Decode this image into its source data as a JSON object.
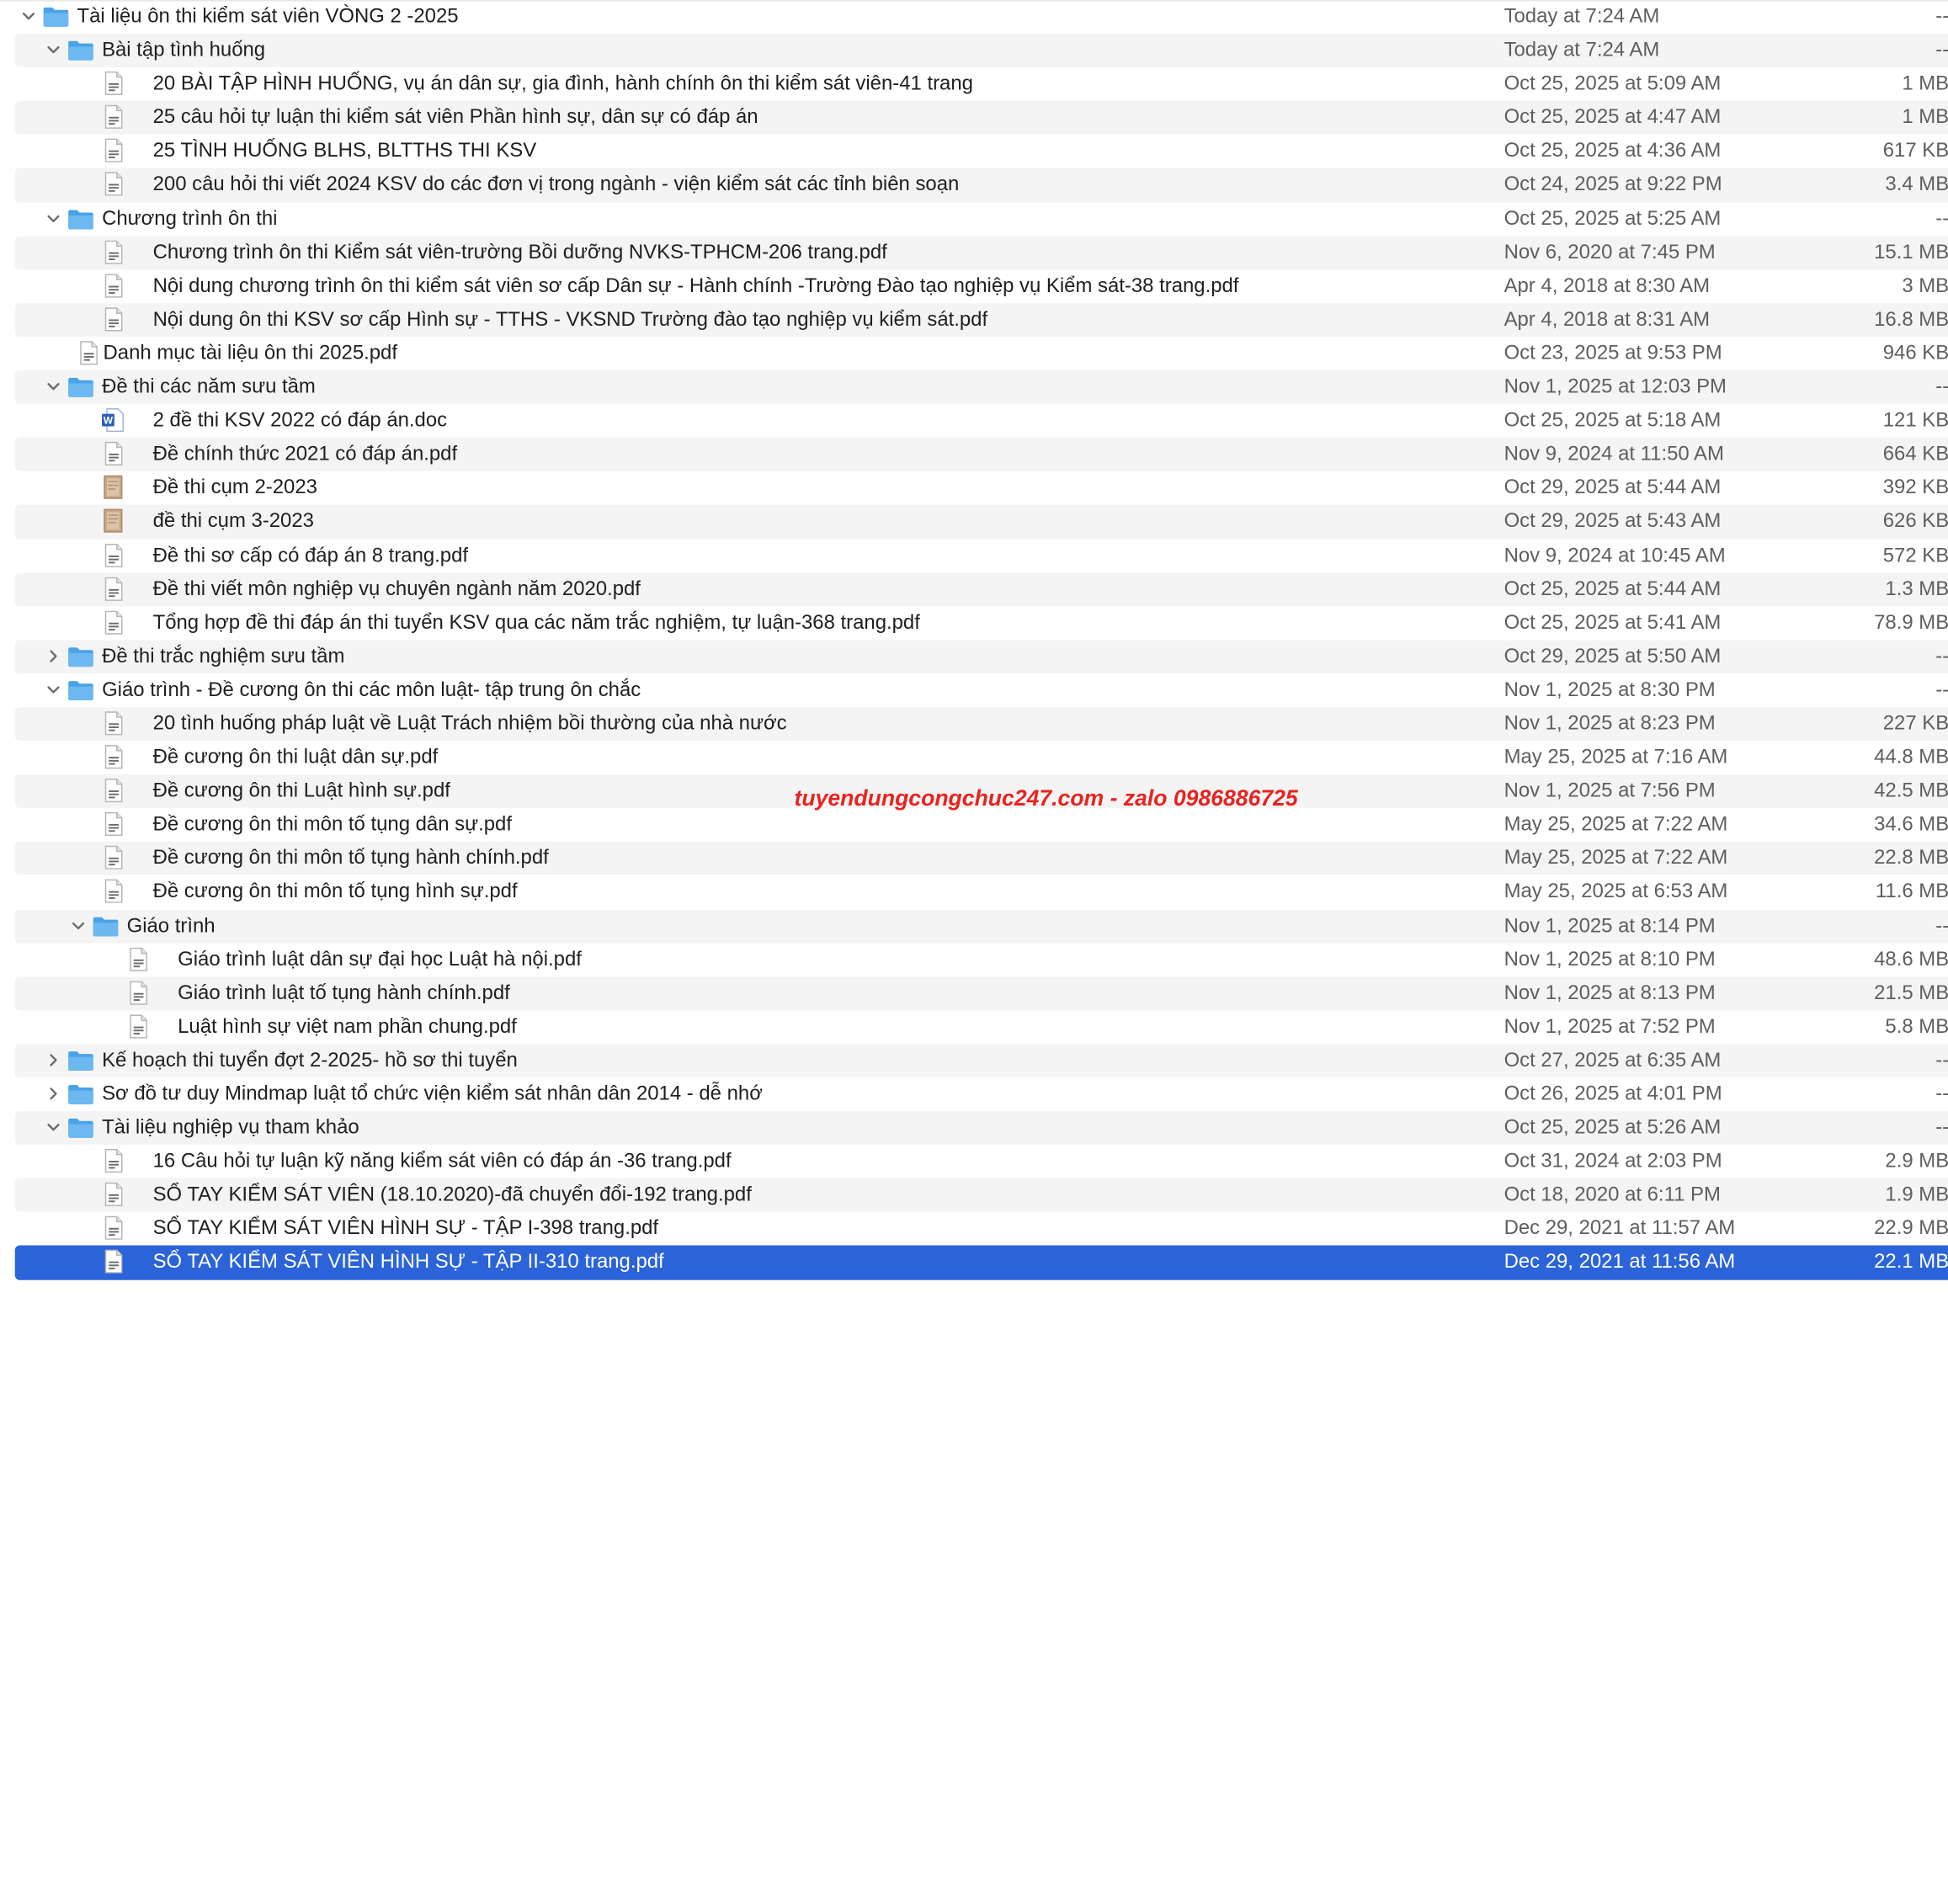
{
  "watermark": "tuyendungcongchuc247.com - zalo 0986886725",
  "colors": {
    "selection": "#2b63d9",
    "folder": "#4aa3e8",
    "stripe": "#f4f4f4",
    "secondary_text": "#5e5e5e",
    "watermark": "#e8231f"
  },
  "rows": [
    {
      "level": 0,
      "type": "folder",
      "expanded": true,
      "name": "Tài liệu ôn thi kiểm sát viên VÒNG 2 -2025",
      "date": "Today at 7:24 AM",
      "size": "--"
    },
    {
      "level": 1,
      "type": "folder",
      "expanded": true,
      "name": "Bài tập tình huống",
      "date": "Today at 7:24 AM",
      "size": "--"
    },
    {
      "level": 2,
      "type": "pdf",
      "name": "20 BÀI TẬP HÌNH HUỐNG, vụ án dân sự, gia đình, hành chính ôn thi kiểm sát viên-41 trang",
      "date": "Oct 25, 2025 at 5:09 AM",
      "size": "1 MB"
    },
    {
      "level": 2,
      "type": "pdf",
      "name": "25 câu hỏi tự luận thi kiểm sát viên Phần hình sự, dân sự có đáp án",
      "date": "Oct 25, 2025 at 4:47 AM",
      "size": "1 MB"
    },
    {
      "level": 2,
      "type": "pdf",
      "name": "25 TÌNH HUỐNG BLHS, BLTTHS THI KSV",
      "date": "Oct 25, 2025 at 4:36 AM",
      "size": "617 KB"
    },
    {
      "level": 2,
      "type": "pdf",
      "name": "200 câu hỏi thi viết 2024 KSV do các đơn vị trong ngành - viện kiểm sát các tỉnh biên soạn",
      "date": "Oct 24, 2025 at 9:22 PM",
      "size": "3.4 MB"
    },
    {
      "level": 1,
      "type": "folder",
      "expanded": true,
      "name": "Chương trình ôn thi",
      "date": "Oct 25, 2025 at 5:25 AM",
      "size": "--"
    },
    {
      "level": 2,
      "type": "pdf",
      "name": "Chương trình ôn thi Kiểm sát viên-trường Bồi dưỡng NVKS-TPHCM-206 trang.pdf",
      "date": "Nov 6, 2020 at 7:45 PM",
      "size": "15.1 MB"
    },
    {
      "level": 2,
      "type": "pdf",
      "name": "Nội dung chương trình ôn thi kiểm sát viên sơ cấp Dân sự - Hành chính -Trường Đào tạo nghiệp vụ Kiểm sát-38 trang.pdf",
      "date": "Apr 4, 2018 at 8:30 AM",
      "size": "3 MB"
    },
    {
      "level": 2,
      "type": "pdf",
      "name": "Nội dung ôn thi KSV sơ cấp Hình sự - TTHS - VKSND Trường đào tạo nghiệp vụ kiểm sát.pdf",
      "date": "Apr 4, 2018 at 8:31 AM",
      "size": "16.8 MB"
    },
    {
      "level": 1,
      "type": "pdf",
      "name": "Danh mục tài liệu ôn thi 2025.pdf",
      "date": "Oct 23, 2025 at 9:53 PM",
      "size": "946 KB"
    },
    {
      "level": 1,
      "type": "folder",
      "expanded": true,
      "name": "Đề thi các năm sưu tầm",
      "date": "Nov 1, 2025 at 12:03 PM",
      "size": "--"
    },
    {
      "level": 2,
      "type": "doc",
      "name": "2 đề thi KSV 2022 có đáp án.doc",
      "date": "Oct 25, 2025 at 5:18 AM",
      "size": "121 KB"
    },
    {
      "level": 2,
      "type": "pdf",
      "name": "Đề chính thức 2021 có đáp án.pdf",
      "date": "Nov 9, 2024 at 11:50 AM",
      "size": "664 KB"
    },
    {
      "level": 2,
      "type": "image",
      "name": "Đề thi cụm 2-2023",
      "date": "Oct 29, 2025 at 5:44 AM",
      "size": "392 KB"
    },
    {
      "level": 2,
      "type": "image",
      "name": "đề thi cụm 3-2023",
      "date": "Oct 29, 2025 at 5:43 AM",
      "size": "626 KB"
    },
    {
      "level": 2,
      "type": "pdf",
      "name": "Đề thi sơ cấp có đáp án 8 trang.pdf",
      "date": "Nov 9, 2024 at 10:45 AM",
      "size": "572 KB"
    },
    {
      "level": 2,
      "type": "pdf",
      "name": "Đề thi viết môn nghiệp vụ chuyên ngành năm 2020.pdf",
      "date": "Oct 25, 2025 at 5:44 AM",
      "size": "1.3 MB"
    },
    {
      "level": 2,
      "type": "pdf",
      "name": "Tổng hợp đề thi đáp án thi tuyển KSV qua các năm trắc nghiệm, tự luận-368 trang.pdf",
      "date": "Oct 25, 2025 at 5:41 AM",
      "size": "78.9 MB"
    },
    {
      "level": 1,
      "type": "folder",
      "expanded": false,
      "name": "Đề thi trắc nghiệm sưu tầm",
      "date": "Oct 29, 2025 at 5:50 AM",
      "size": "--"
    },
    {
      "level": 1,
      "type": "folder",
      "expanded": true,
      "name": "Giáo trình - Đề cương ôn thi các môn luật- tập trung ôn chắc",
      "date": "Nov 1, 2025 at 8:30 PM",
      "size": "--"
    },
    {
      "level": 2,
      "type": "pdf",
      "name": "20 tình huống pháp luật về Luật Trách nhiệm bồi thường của nhà nước",
      "date": "Nov 1, 2025 at 8:23 PM",
      "size": "227 KB"
    },
    {
      "level": 2,
      "type": "pdf",
      "name": "Đề cương ôn thi luật dân sự.pdf",
      "date": "May 25, 2025 at 7:16 AM",
      "size": "44.8 MB"
    },
    {
      "level": 2,
      "type": "pdf",
      "name": "Đề cương ôn thi Luật hình sự.pdf",
      "date": "Nov 1, 2025 at 7:56 PM",
      "size": "42.5 MB"
    },
    {
      "level": 2,
      "type": "pdf",
      "name": "Đề cương ôn thi môn tố tụng dân sự.pdf",
      "date": "May 25, 2025 at 7:22 AM",
      "size": "34.6 MB"
    },
    {
      "level": 2,
      "type": "pdf",
      "name": "Đề cương ôn thi môn tố tụng hành chính.pdf",
      "date": "May 25, 2025 at 7:22 AM",
      "size": "22.8 MB"
    },
    {
      "level": 2,
      "type": "pdf",
      "name": "Đề cương ôn thi môn tố tụng hình sự.pdf",
      "date": "May 25, 2025 at 6:53 AM",
      "size": "11.6 MB"
    },
    {
      "level": 2,
      "type": "folder",
      "expanded": true,
      "name": "Giáo trình",
      "date": "Nov 1, 2025 at 8:14 PM",
      "size": "--"
    },
    {
      "level": 3,
      "type": "pdf",
      "name": "Giáo trình luật dân sự đại học Luật hà nội.pdf",
      "date": "Nov 1, 2025 at 8:10 PM",
      "size": "48.6 MB"
    },
    {
      "level": 3,
      "type": "pdf",
      "name": "Giáo trình luật tố tụng hành chính.pdf",
      "date": "Nov 1, 2025 at 8:13 PM",
      "size": "21.5 MB"
    },
    {
      "level": 3,
      "type": "pdf",
      "name": "Luật hình sự việt nam phần chung.pdf",
      "date": "Nov 1, 2025 at 7:52 PM",
      "size": "5.8 MB"
    },
    {
      "level": 1,
      "type": "folder",
      "expanded": false,
      "name": "Kế hoạch thi tuyển đợt 2-2025- hồ sơ thi tuyển",
      "date": "Oct 27, 2025 at 6:35 AM",
      "size": "--"
    },
    {
      "level": 1,
      "type": "folder",
      "expanded": false,
      "name": "Sơ đồ tư duy Mindmap luật tổ chức viện kiểm sát nhân dân 2014 - dễ nhớ",
      "date": "Oct 26, 2025 at 4:01 PM",
      "size": "--"
    },
    {
      "level": 1,
      "type": "folder",
      "expanded": true,
      "name": "Tài liệu nghiệp vụ tham khảo",
      "date": "Oct 25, 2025 at 5:26 AM",
      "size": "--"
    },
    {
      "level": 2,
      "type": "pdf",
      "name": "16 Câu hỏi tự luận kỹ năng kiểm sát viên có đáp án -36 trang.pdf",
      "date": "Oct 31, 2024 at 2:03 PM",
      "size": "2.9 MB"
    },
    {
      "level": 2,
      "type": "pdf",
      "name": "SỔ TAY KIỂM SÁT VIÊN (18.10.2020)-đã chuyển đổi-192 trang.pdf",
      "date": "Oct 18, 2020 at 6:11 PM",
      "size": "1.9 MB"
    },
    {
      "level": 2,
      "type": "pdf",
      "name": "SỔ TAY KIỂM SÁT VIÊN HÌNH SỰ - TẬP I-398 trang.pdf",
      "date": "Dec 29, 2021 at 11:57 AM",
      "size": "22.9 MB"
    },
    {
      "level": 2,
      "type": "pdf",
      "selected": true,
      "name": "SỔ TAY KIỂM SÁT VIÊN HÌNH SỰ - TẬP II-310 trang.pdf",
      "date": "Dec 29, 2021 at 11:56 AM",
      "size": "22.1 MB"
    }
  ]
}
